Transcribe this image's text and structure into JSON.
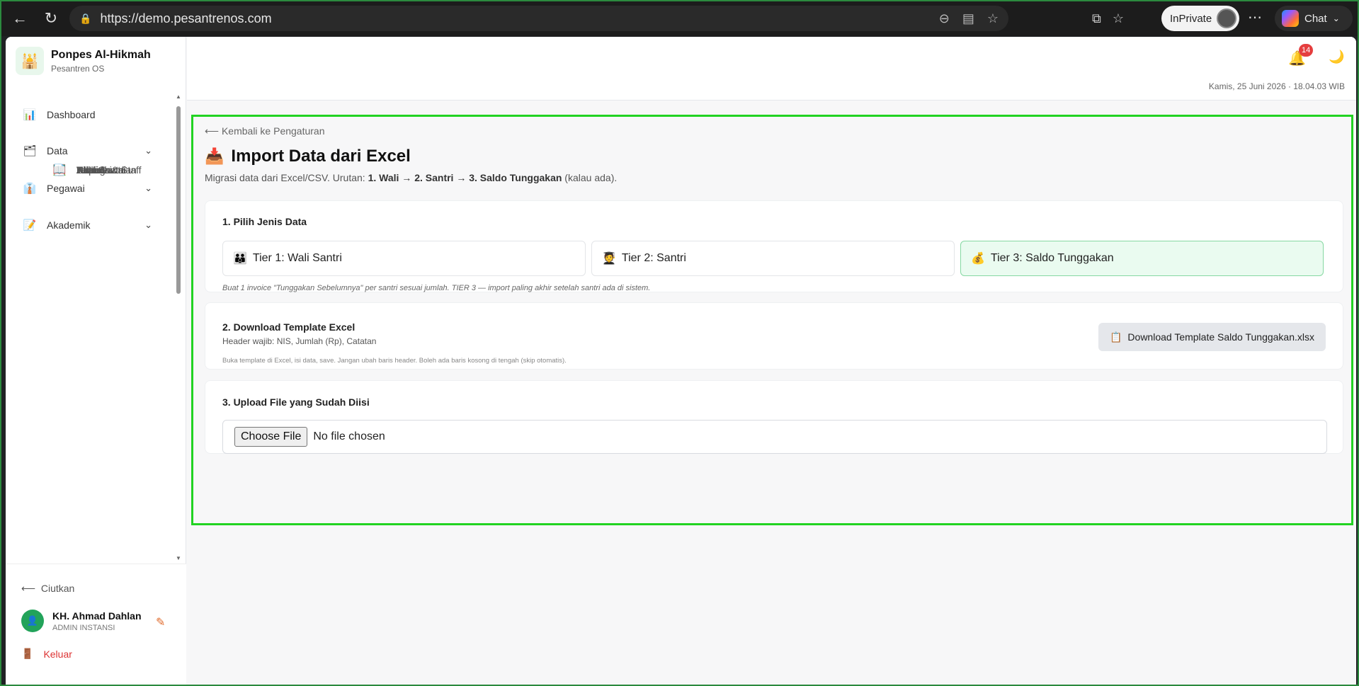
{
  "browser": {
    "url": "https://demo.pesantrenos.com",
    "inprivate": "InPrivate",
    "chat": "Chat"
  },
  "sidebar": {
    "brand_name": "Ponpes Al-Hikmah",
    "brand_sub": "Pesantren OS",
    "items": [
      {
        "label": "Dashboard",
        "icon": "📊"
      },
      {
        "label": "Data",
        "icon": "🗂",
        "chev": "⌄"
      },
      {
        "label": "Data Santri",
        "icon": "🧑‍🎓"
      },
      {
        "label": "Wali Santri",
        "icon": "👪"
      },
      {
        "label": "Alumni",
        "icon": "🎓"
      },
      {
        "label": "Kelas",
        "icon": "🏫"
      },
      {
        "label": "Asrama",
        "icon": "🏠"
      },
      {
        "label": "Pegawai",
        "icon": "👔",
        "chev": "⌄"
      },
      {
        "label": "Asatidz & Staff",
        "icon": "👨‍🏫"
      },
      {
        "label": "Kepegawaian",
        "icon": "🪪"
      },
      {
        "label": "Akademik",
        "icon": "📝",
        "chev": "⌄"
      },
      {
        "label": "Absensi",
        "icon": "📋"
      },
      {
        "label": "Nilai",
        "icon": "📄"
      },
      {
        "label": "Tahfidz",
        "icon": "📖"
      }
    ],
    "collapse_label": "Ciutkan",
    "user_name": "KH. Ahmad Dahlan",
    "user_role": "ADMIN INSTANSI",
    "logout_label": "Keluar"
  },
  "header": {
    "notif_count": "14",
    "datetime": "Kamis, 25 Juni 2026 · 18.04.03 WIB"
  },
  "page": {
    "back_label": "⟵ Kembali ke Pengaturan",
    "title": "Import Data dari Excel",
    "subtitle_prefix": "Migrasi data dari Excel/CSV. Urutan: ",
    "subtitle_bold": "1. Wali → 2. Santri → 3. Saldo Tunggakan",
    "subtitle_suffix": " (kalau ada).",
    "step1_title": "1. Pilih Jenis Data",
    "tiers": [
      {
        "label": "Tier 1: Wali Santri",
        "icon": "👪"
      },
      {
        "label": "Tier 2: Santri",
        "icon": "🧑‍🎓"
      },
      {
        "label": "Tier 3: Saldo Tunggakan",
        "icon": "💰"
      }
    ],
    "step1_hint": "Buat 1 invoice \"Tunggakan Sebelumnya\" per santri sesuai jumlah. TIER 3 — import paling akhir setelah santri ada di sistem.",
    "step2_title": "2. Download Template Excel",
    "step2_meta": "Header wajib: NIS, Jumlah (Rp), Catatan",
    "step2_hint": "Buka template di Excel, isi data, save. Jangan ubah baris header. Boleh ada baris kosong di tengah (skip otomatis).",
    "download_label": "Download Template Saldo Tunggakan.xlsx",
    "step3_title": "3. Upload File yang Sudah Diisi",
    "choose_label": "Choose File",
    "no_file_label": "No file chosen"
  }
}
